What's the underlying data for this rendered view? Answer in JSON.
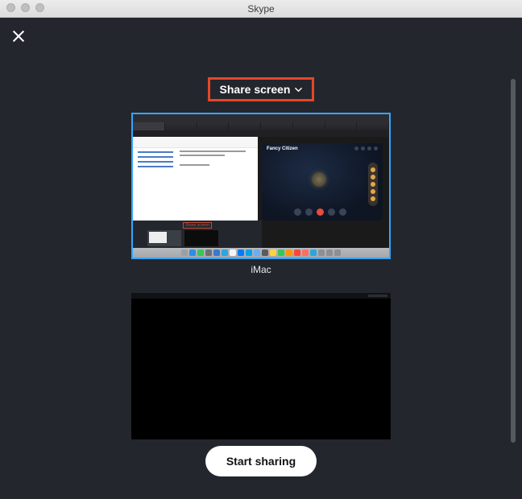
{
  "window": {
    "title": "Skype"
  },
  "header": {
    "dropdown_label": "Share screen"
  },
  "screens": {
    "selected_label": "iMac",
    "skype_overlay_name": "Fancy Citizen"
  },
  "footer": {
    "start_label": "Start sharing"
  },
  "highlight": {
    "color": "#e4472a"
  },
  "dock_icon_colors": [
    "#9aa0a6",
    "#2f8de4",
    "#34c759",
    "#6f6f6f",
    "#3a79d0",
    "#2aa6de",
    "#f5f5f5",
    "#007aff",
    "#00a2ed",
    "#6aaef0",
    "#5b5b5b",
    "#ffd33d",
    "#34c759",
    "#ff9500",
    "#ff453a",
    "#ff6f61",
    "#2aa6de",
    "#8e8e93",
    "#8e8e93",
    "#8e8e93"
  ]
}
